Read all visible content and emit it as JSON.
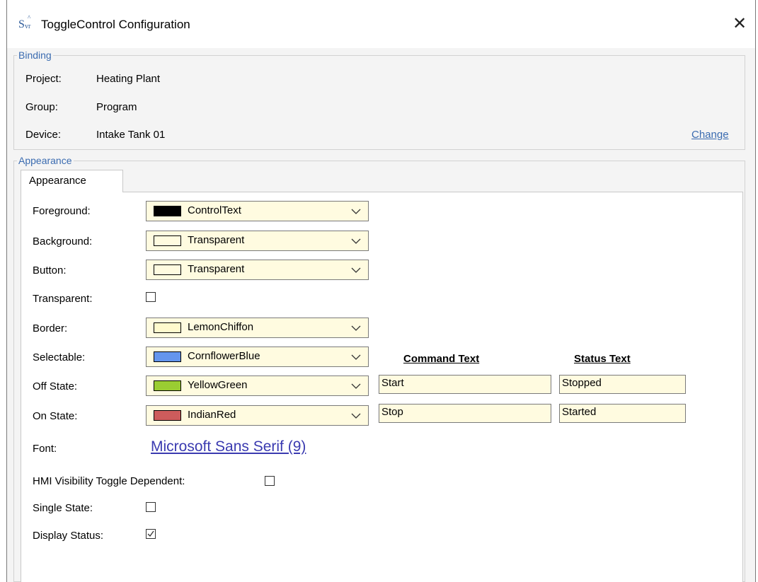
{
  "window": {
    "title": "ToggleControl Configuration",
    "close_glyph": "✕"
  },
  "binding": {
    "legend": "Binding",
    "project_label": "Project:",
    "project_value": "Heating Plant",
    "group_label": "Group:",
    "group_value": "Program",
    "device_label": "Device:",
    "device_value": "Intake Tank 01",
    "change_link": "Change"
  },
  "appearance": {
    "legend": "Appearance",
    "tab_label": "Appearance",
    "rows": {
      "foreground": {
        "label": "Foreground:",
        "value": "ControlText",
        "color": "#000000"
      },
      "background": {
        "label": "Background:",
        "value": "Transparent",
        "color": "#fffbe0"
      },
      "button": {
        "label": "Button:",
        "value": "Transparent",
        "color": "#fffbe0"
      },
      "border": {
        "label": "Border:",
        "value": "LemonChiffon",
        "color": "#fffacd"
      },
      "selectable": {
        "label": "Selectable:",
        "value": "CornflowerBlue",
        "color": "#6495ed"
      },
      "off_state": {
        "label": "Off State:",
        "value": "YellowGreen",
        "color": "#9acd32",
        "command_text": "Start",
        "status_text": "Stopped"
      },
      "on_state": {
        "label": "On State:",
        "value": "IndianRed",
        "color": "#cd5c5c",
        "command_text": "Stop",
        "status_text": "Started"
      }
    },
    "transparent_label": "Transparent:",
    "transparent_checked": false,
    "command_text_header": "Command Text",
    "status_text_header": "Status Text",
    "font_label": "Font:",
    "font_value": "Microsoft Sans Serif (9)",
    "hmi_visibility_label": "HMI Visibility Toggle Dependent:",
    "hmi_visibility_checked": false,
    "single_state_label": "Single State:",
    "single_state_checked": false,
    "display_status_label": "Display Status:",
    "display_status_checked": true
  },
  "colors": {
    "field_background": "#fffbe0",
    "legend_accent": "#3a6bb0",
    "font_link": "#3a3ab0"
  },
  "icons": {
    "app": "svr-app-icon",
    "close": "close-icon",
    "dropdown": "chevron-down-icon",
    "check": "check-icon"
  }
}
